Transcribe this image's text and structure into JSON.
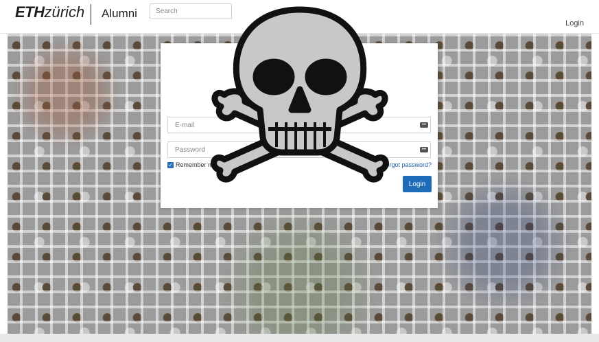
{
  "header": {
    "logo_eth": "ETH",
    "logo_zurich": "zürich",
    "site_name": "Alumni",
    "search_placeholder": "Search",
    "login_link": "Login"
  },
  "login_form": {
    "email_placeholder": "E-mail",
    "password_placeholder": "Password",
    "remember_label": "Remember me",
    "remember_checked": true,
    "forgot_label": "Forgot password?",
    "submit_label": "Login"
  },
  "overlay": {
    "icon": "skull-and-crossbones-icon"
  },
  "colors": {
    "primary": "#1e6bb8",
    "link": "#1f5fa8"
  }
}
